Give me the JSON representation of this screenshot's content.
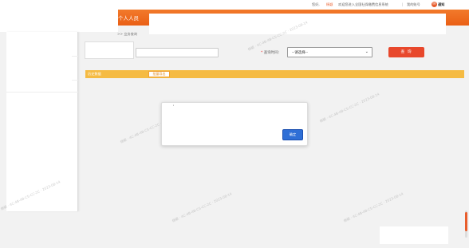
{
  "topbar": {
    "greeting": "您好,",
    "username": "杨颖",
    "welcome": "欢迎您进入全国社保缴费信息系统",
    "separator": "|",
    "account": "我的账号",
    "notice": "通知"
  },
  "header": {
    "app_title": "个人人员"
  },
  "breadcrumb": ">> 业务查询",
  "query": {
    "time_label": "查询时间:",
    "time_required_mark": "*",
    "time_select_value": "--请选择--",
    "query_button": "查 询"
  },
  "results": {
    "label": "历史数据",
    "export_button": "批量导出"
  },
  "modal": {
    "message": "'",
    "confirm_button": "确定"
  },
  "watermark": "杨颖 · 4C-4B-4B-C5-CC-2C · 2023-08-14",
  "colors": {
    "brand_orange": "#ea5f15",
    "query_red": "#e8482c",
    "result_yellow": "#f5bb43",
    "confirm_blue": "#2f6fd6"
  }
}
